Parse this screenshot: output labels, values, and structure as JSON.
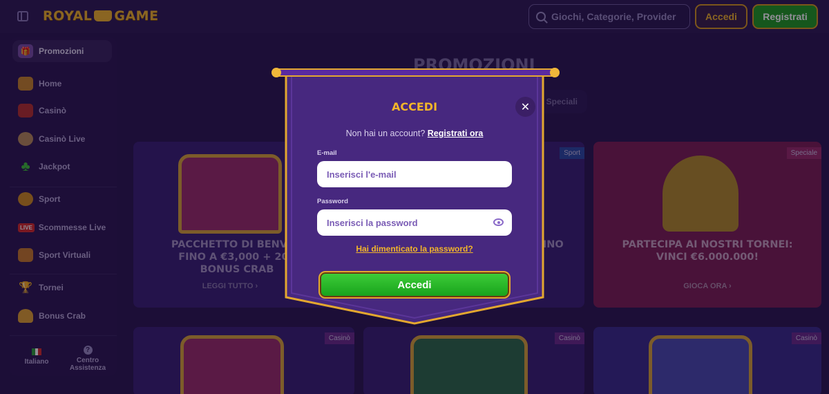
{
  "header": {
    "logo_text_left": "ROYAL",
    "logo_text_right": "GAME",
    "search_placeholder": "Giochi, Categorie, Provider",
    "login_label": "Accedi",
    "register_label": "Registrati"
  },
  "sidebar": {
    "items": [
      {
        "label": "Promozioni",
        "icon": "gift-icon"
      },
      {
        "label": "Home",
        "icon": "home-icon"
      },
      {
        "label": "Casinò",
        "icon": "slot-icon"
      },
      {
        "label": "Casinò Live",
        "icon": "dealer-icon"
      },
      {
        "label": "Jackpot",
        "icon": "clover-icon"
      },
      {
        "label": "Sport",
        "icon": "ball-icon"
      },
      {
        "label": "Scommesse Live",
        "icon": "live-icon",
        "badge": "LIVE"
      },
      {
        "label": "Sport Virtuali",
        "icon": "gamepad-icon"
      },
      {
        "label": "Tornei",
        "icon": "trophy-icon"
      },
      {
        "label": "Bonus Crab",
        "icon": "crab-icon"
      }
    ],
    "language_label": "Italiano",
    "help_label_line1": "Centro",
    "help_label_line2": "Assistenza"
  },
  "main": {
    "title": "PROMOZIONI",
    "filter_chip": "Speciali",
    "cards": [
      {
        "tag": "",
        "title_line1": "PACCHETTO DI BENVEN",
        "title_line2": "FINO A €3,000 + 200",
        "title_line3": "BONUS CRAB",
        "link": "LEGGI TUTTO"
      },
      {
        "tag": "Sport",
        "title_line1": "TINO",
        "link": ""
      },
      {
        "tag": "Speciale",
        "title_line1": "PARTECIPA AI NOSTRI TORNEI:",
        "title_line2": "VINCI €6.000.000!",
        "link": "GIOCA ORA"
      },
      {
        "tag": "Casinò"
      },
      {
        "tag": "Casinò"
      },
      {
        "tag": "Casinò"
      }
    ]
  },
  "modal": {
    "title": "ACCEDI",
    "no_account_text": "Non hai un account?",
    "register_link": "Registrati ora",
    "email_label": "E-mail",
    "email_placeholder": "Inserisci l'e-mail",
    "password_label": "Password",
    "password_placeholder": "Inserisci la password",
    "forgot_link": "Hai dimenticato la password?",
    "submit_label": "Accedi",
    "close_glyph": "✕"
  },
  "colors": {
    "background": "#2a1650",
    "accent_gold": "#f2b52a",
    "modal_purple": "#4a2a8a",
    "button_green": "#22b422",
    "pink_card": "#8c1f5e"
  }
}
